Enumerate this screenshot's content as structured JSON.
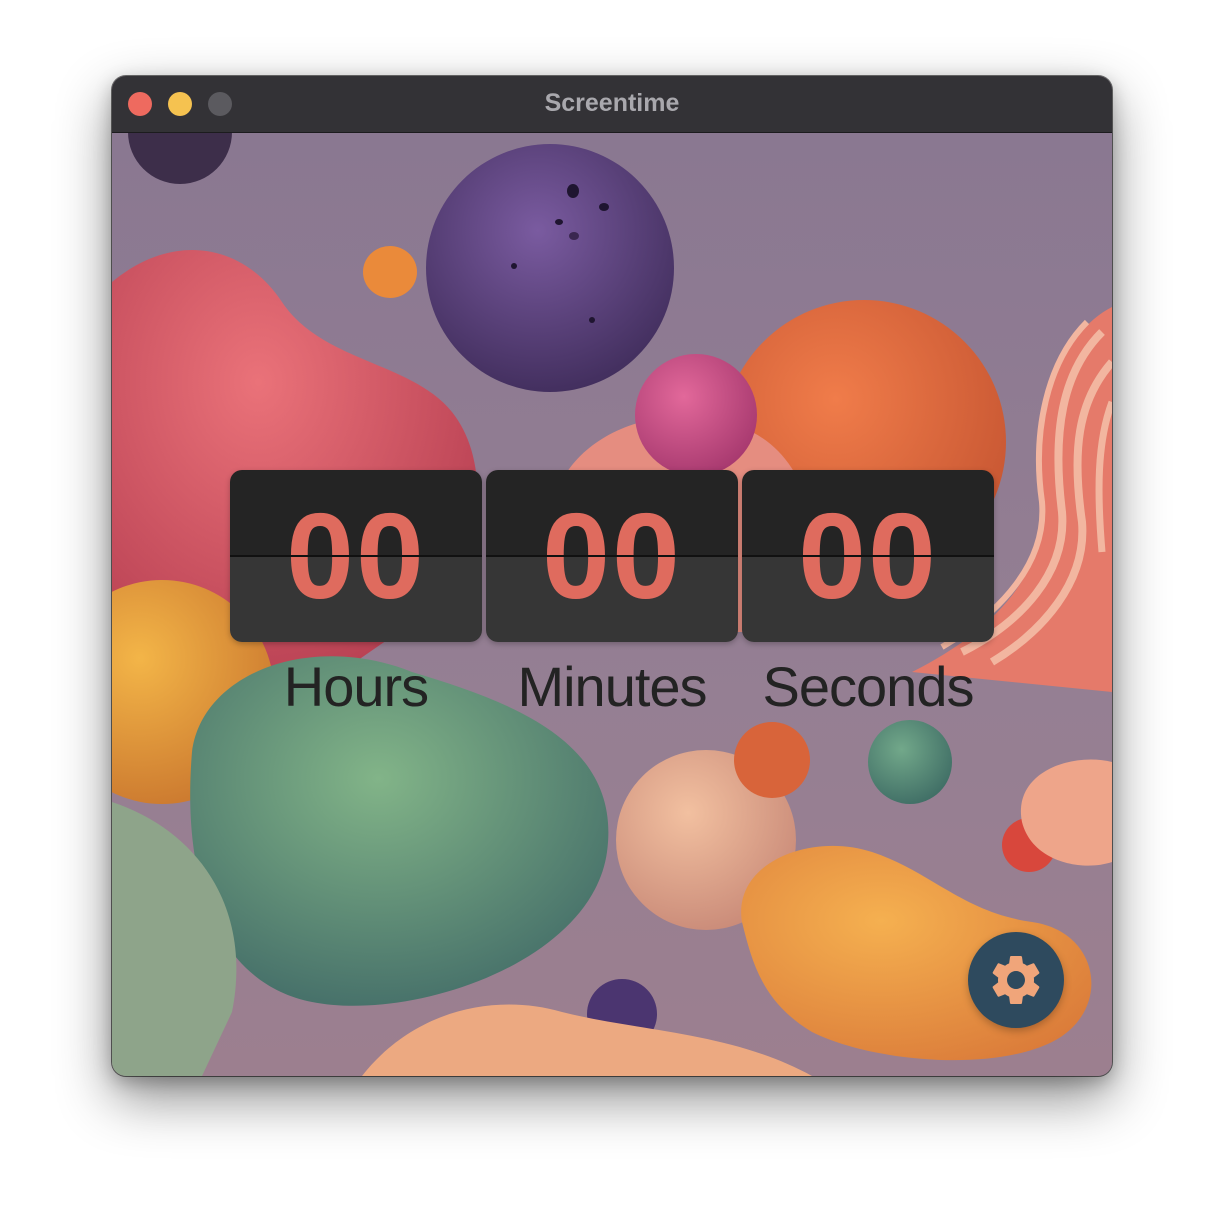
{
  "window": {
    "title": "Screentime"
  },
  "timer": {
    "hours": {
      "value": "00",
      "label": "Hours"
    },
    "minutes": {
      "value": "00",
      "label": "Minutes"
    },
    "seconds": {
      "value": "00",
      "label": "Seconds"
    }
  },
  "colors": {
    "titlebar": "#333236",
    "close": "#ee6a5f",
    "minimize": "#f5c250",
    "zoom_disabled": "#5b5a5f",
    "digit": "#df6b5e",
    "card_top": "#242424",
    "card_bottom": "#363636",
    "label": "#232323",
    "settings_bg": "#2e4a5e",
    "settings_icon": "#f0a57a"
  },
  "icons": {
    "settings": "gear-icon",
    "wallpaper": "abstract-3d-blobs-wallpaper"
  }
}
